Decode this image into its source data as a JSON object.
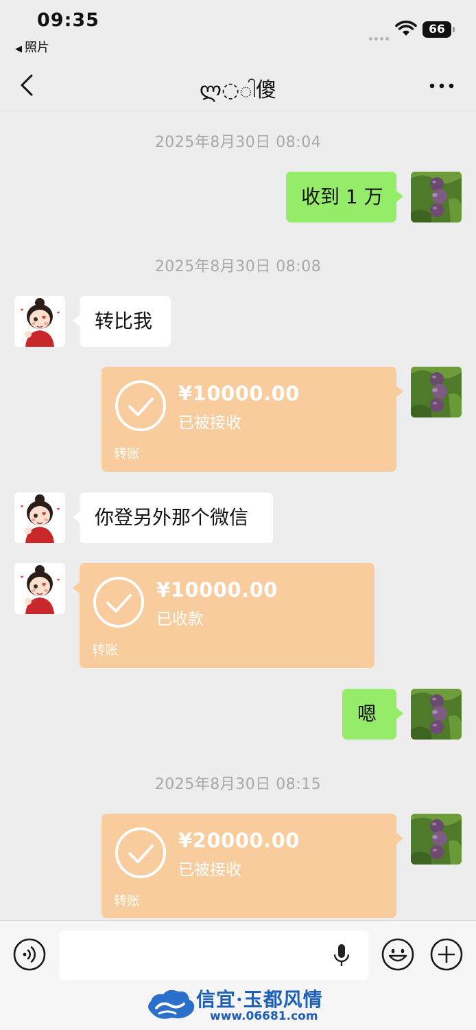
{
  "status_bar": {
    "time": "09:35",
    "back_app": "照片",
    "battery": "66"
  },
  "nav": {
    "title": "ლ◌ါ傻"
  },
  "messages": [
    {
      "type": "timestamp",
      "text": "2025年8月30日 08:04"
    },
    {
      "type": "text",
      "side": "right",
      "text": "收到 1 万"
    },
    {
      "type": "timestamp",
      "text": "2025年8月30日 08:08"
    },
    {
      "type": "text",
      "side": "left",
      "text": "转比我"
    },
    {
      "type": "transfer",
      "side": "right",
      "amount": "¥10000.00",
      "state": "已被接收",
      "kind": "转账"
    },
    {
      "type": "text",
      "side": "left",
      "text": "你登另外那个微信"
    },
    {
      "type": "transfer",
      "side": "left",
      "amount": "¥10000.00",
      "state": "已收款",
      "kind": "转账"
    },
    {
      "type": "text",
      "side": "right",
      "text": "嗯"
    },
    {
      "type": "timestamp",
      "text": "2025年8月30日 08:15"
    },
    {
      "type": "transfer",
      "side": "right",
      "amount": "¥20000.00",
      "state": "已被接收",
      "kind": "转账"
    }
  ],
  "input": {
    "value": "",
    "placeholder": ""
  },
  "watermark": {
    "title": "信宜·玉都风情",
    "url": "www.06681.com"
  },
  "colors": {
    "background": "#ededed",
    "green_bubble": "#95ec69",
    "transfer_bubble": "#f9cc9d",
    "timestamp": "#a8a8a8"
  }
}
